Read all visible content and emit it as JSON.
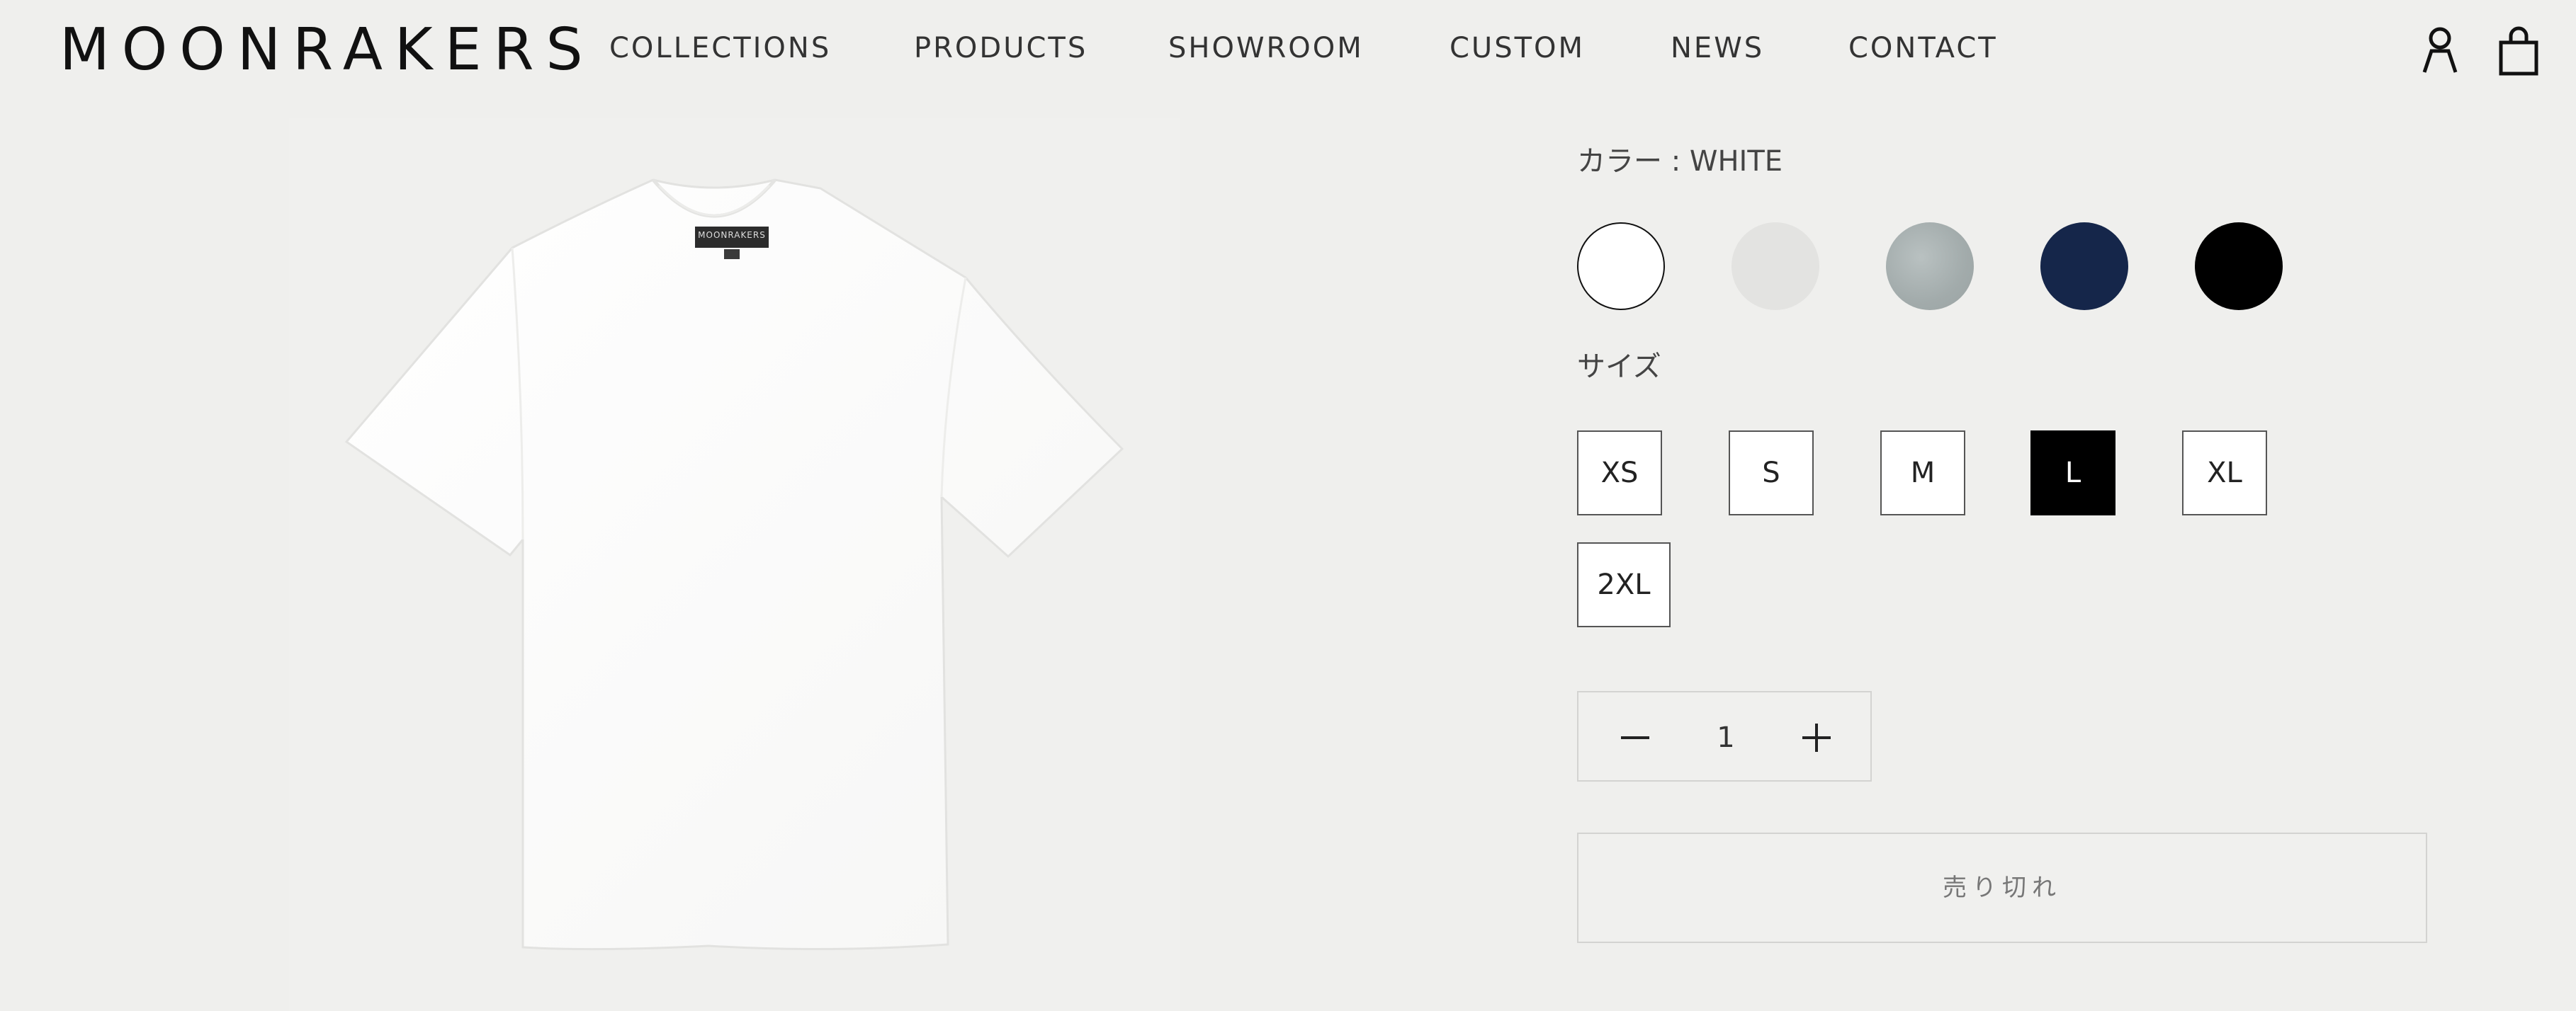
{
  "header": {
    "logo": "MOONRAKERS",
    "nav": [
      {
        "label": "COLLECTIONS"
      },
      {
        "label": "PRODUCTS"
      },
      {
        "label": "SHOWROOM"
      },
      {
        "label": "CUSTOM"
      },
      {
        "label": "NEWS"
      },
      {
        "label": "CONTACT"
      }
    ],
    "icons": [
      "account-icon",
      "shopping-bag-icon"
    ]
  },
  "product": {
    "image_icon": "white-tshirt",
    "tag_text": "MOONRAKERS",
    "color": {
      "label": "カラー : WHITE",
      "swatches": [
        {
          "name": "white",
          "hex": "#ffffff",
          "selected": true
        },
        {
          "name": "light-gray",
          "hex": "#e3e3e1",
          "selected": false
        },
        {
          "name": "heather-gray",
          "hex": "#a7b0b0",
          "selected": false
        },
        {
          "name": "navy",
          "hex": "#15264a",
          "selected": false
        },
        {
          "name": "black",
          "hex": "#000000",
          "selected": false
        }
      ]
    },
    "size": {
      "label": "サイズ",
      "options": [
        {
          "label": "XS",
          "selected": false
        },
        {
          "label": "S",
          "selected": false
        },
        {
          "label": "M",
          "selected": false
        },
        {
          "label": "L",
          "selected": true
        },
        {
          "label": "XL",
          "selected": false
        },
        {
          "label": "2XL",
          "selected": false
        }
      ]
    },
    "quantity": {
      "value": "1",
      "decrease_icon": "minus-icon",
      "increase_icon": "plus-icon"
    },
    "soldout_label": "売り切れ"
  }
}
